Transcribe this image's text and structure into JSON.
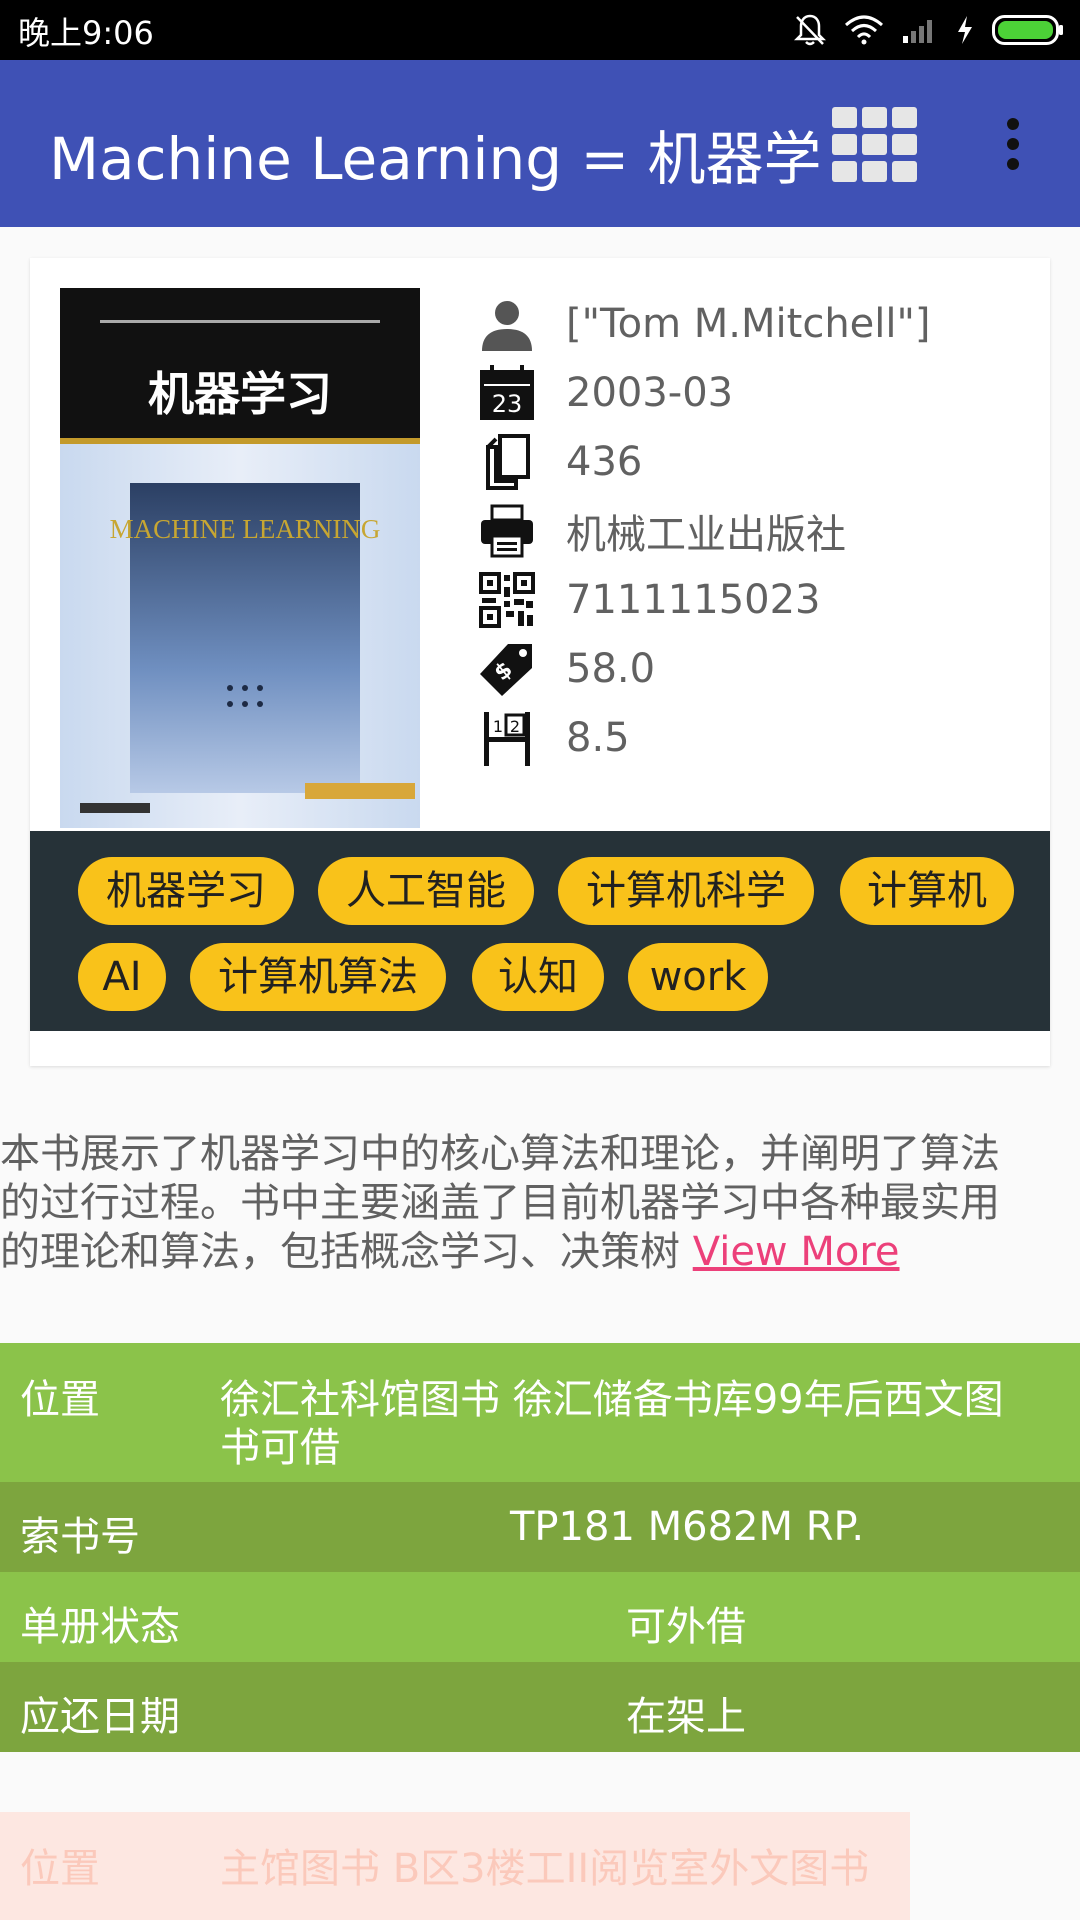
{
  "status_bar": {
    "time": "晚上9:06"
  },
  "app_bar": {
    "title": "Machine Learning = 机器学"
  },
  "book": {
    "cover_title": "机器学习",
    "cover_subtitle": "MACHINE LEARNING",
    "info": [
      {
        "icon": "person-icon",
        "value": "[\"Tom M.Mitchell\"]"
      },
      {
        "icon": "calendar-icon",
        "value": "2003-03",
        "icon_text": "23"
      },
      {
        "icon": "pages-icon",
        "value": "436"
      },
      {
        "icon": "printer-icon",
        "value": "机械工业出版社"
      },
      {
        "icon": "qrcode-icon",
        "value": "7111115023"
      },
      {
        "icon": "price-tag-icon",
        "value": "58.0"
      },
      {
        "icon": "rating-board-icon",
        "value": "8.5"
      }
    ]
  },
  "tags": [
    "机器学习",
    "人工智能",
    "计算机科学",
    "计算机",
    "AI",
    "计算机算法",
    "认知",
    "work"
  ],
  "summary": {
    "lines": [
      "本书展示了机器学习中的核心算法和理论，并阐明了算法",
      "的过行过程。书中主要涵盖了目前机器学习中各种最实用",
      "的理论和算法，包括概念学习、决策树 "
    ],
    "view_more": "View More"
  },
  "holdings": [
    {
      "label": "位置",
      "value_line1": "徐汇社科馆图书 徐汇储备书库99年后西文图",
      "value_line2": "书可借"
    },
    {
      "label": "索书号",
      "value": "TP181 M682M RP."
    },
    {
      "label": "单册状态",
      "value": "可外借"
    },
    {
      "label": "应还日期",
      "value": "在架上"
    }
  ],
  "faded_row": {
    "label": "位置",
    "value": "主馆图书 B区3楼工II阅览室外文图书"
  },
  "colors": {
    "app_bar": "#3f51b5",
    "tag_bg": "#f9c21a",
    "tag_bar": "#263238",
    "row_light": "#8bc34a",
    "row_dark": "#7da53e",
    "link": "#ec407a"
  }
}
